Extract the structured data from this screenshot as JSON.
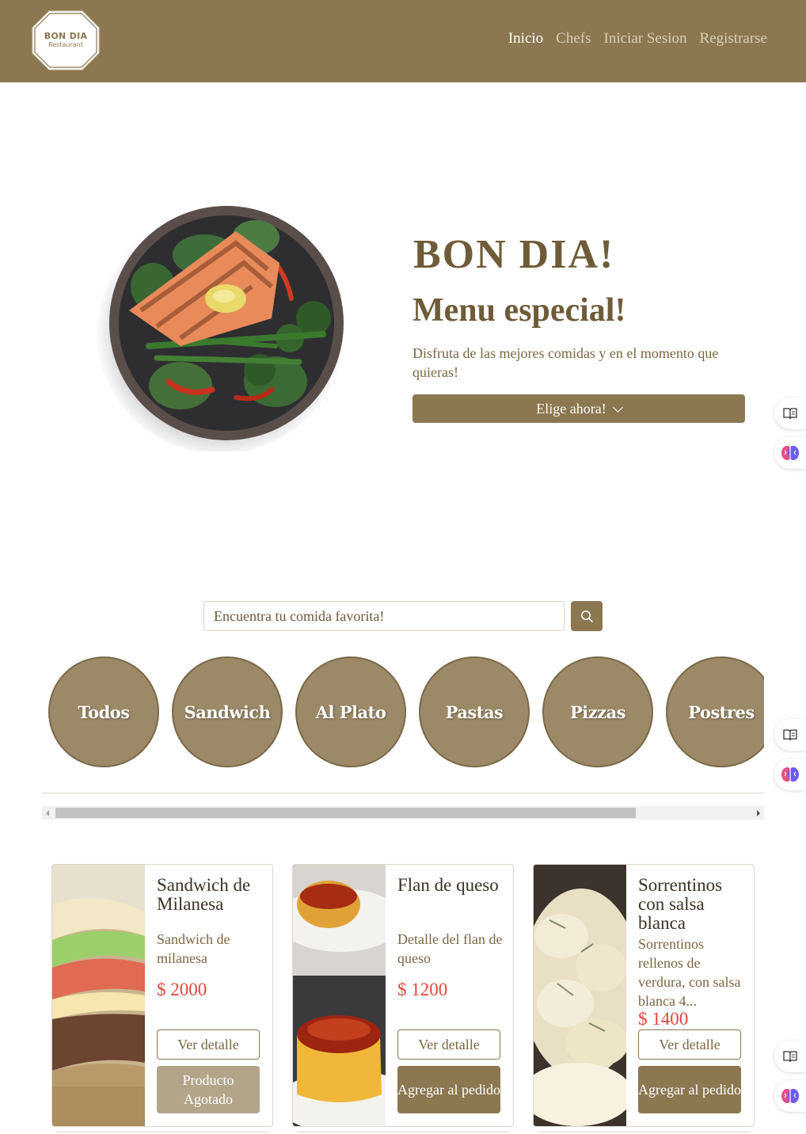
{
  "brand": {
    "name": "BON DIA",
    "tagline": "Restaurant"
  },
  "nav": {
    "items": [
      {
        "label": "Inicio",
        "active": true
      },
      {
        "label": "Chefs",
        "active": false
      },
      {
        "label": "Iniciar Sesion",
        "active": false
      },
      {
        "label": "Registrarse",
        "active": false
      }
    ]
  },
  "hero": {
    "title": "BON DIA!",
    "subtitle": "Menu especial!",
    "description": "Disfruta de las mejores comidas y en el momento que quieras!",
    "cta_label": "Elige ahora!",
    "image_icon": "grilled-salmon-plate"
  },
  "search": {
    "placeholder": "Encuentra tu comida favorita!",
    "button_icon": "search-icon"
  },
  "categories": [
    "Todos",
    "Sandwich",
    "Al Plato",
    "Pastas",
    "Pizzas",
    "Postres"
  ],
  "products": [
    {
      "title": "Sandwich de Milanesa",
      "description": "Sandwich de milanesa",
      "price": "$ 2000",
      "detail_label": "Ver detalle",
      "action_label": "Producto Agotado",
      "available": false
    },
    {
      "title": "Flan de queso",
      "description": "Detalle del flan de queso",
      "price": "$ 1200",
      "detail_label": "Ver detalle",
      "action_label": "Agregar al pedido",
      "available": true
    },
    {
      "title": "Sorrentinos con salsa blanca",
      "description": "Sorrentinos rellenos de verdura, con salsa blanca 4...",
      "price": "$ 1400",
      "detail_label": "Ver detalle",
      "action_label": "Agregar al pedido",
      "available": true
    }
  ],
  "colors": {
    "brand": "#8b7750",
    "category": "#9b8967",
    "price": "#e2463c",
    "disabled": "#b3a58a"
  },
  "side_widgets": [
    "book-icon",
    "brain-icon"
  ]
}
